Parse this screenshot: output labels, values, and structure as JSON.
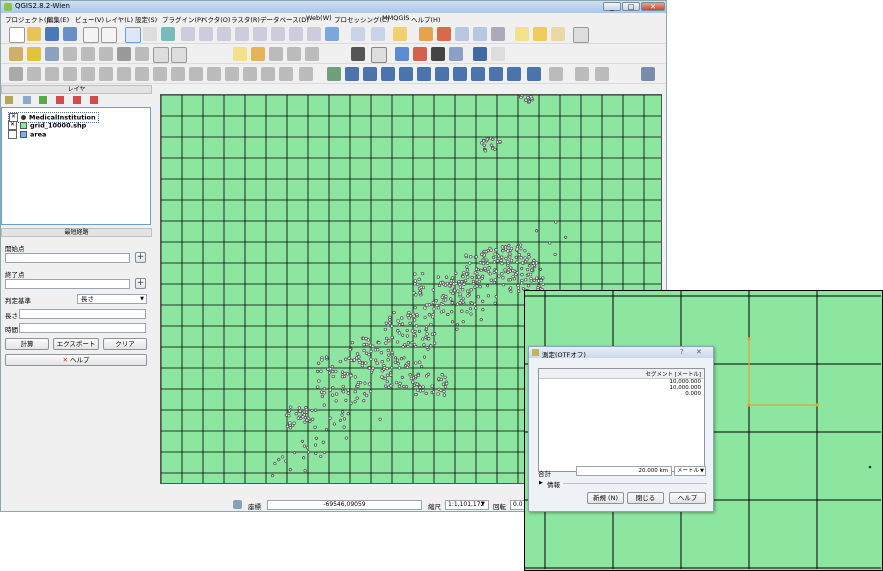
{
  "window": {
    "title": "QGIS2.8.2-Wien",
    "controls": [
      "_",
      "□",
      "✕"
    ]
  },
  "menubar": [
    "プロジェクト(J)",
    "編集(E)",
    "ビュー(V)",
    "レイヤ(L)",
    "設定(S)",
    "プラグイン(P)",
    "ベクタ(O)",
    "ラスタ(R)",
    "データベース(D)",
    "Web(W)",
    "プロセッシング(C)",
    "MMQGIS",
    "ヘルプ(H)"
  ],
  "colors": {
    "map_fill": "#8de6a0",
    "grid_line": "#000000",
    "points": "#4a4a4a",
    "measure_line": "#e2a23a",
    "layers_border": "#6d9ecf"
  },
  "layers_panel": {
    "title": "レイヤ",
    "items": [
      {
        "name": "MedicalInstitution",
        "checked": true,
        "swatch": "point"
      },
      {
        "name": "grid_10000.shp",
        "checked": true,
        "swatch": "#8de6a0"
      },
      {
        "name": "area",
        "checked": false,
        "swatch": "#7aaef0"
      }
    ]
  },
  "route_panel": {
    "title": "最短経路",
    "start_label": "開始点",
    "end_label": "終了点",
    "criterion_label": "判定基準",
    "criterion_value": "長さ",
    "length_label": "長さ",
    "time_label": "時間",
    "calc_button": "計算",
    "export_button": "エクスポート",
    "clear_button": "クリア",
    "help_button": "ヘルプ"
  },
  "statusbar": {
    "coord_label": "座標",
    "coord_value": "-69546,09059",
    "scale_label": "縮尺",
    "scale_value": "1:1,101,172",
    "rotation_label": "回転",
    "rotation_value": "0.0"
  },
  "measure_dialog": {
    "title": "測定(OTFオフ)",
    "column_header": "セグメント [メートル]",
    "segments": [
      "10,000.000",
      "10,000.000",
      "0.000"
    ],
    "total_label": "合計",
    "total_value": "20.000 km",
    "unit_value": "メートル",
    "info_label": "情報",
    "new_button": "新規 (N)",
    "close_button": "閉じる",
    "help_button": "ヘルプ"
  }
}
